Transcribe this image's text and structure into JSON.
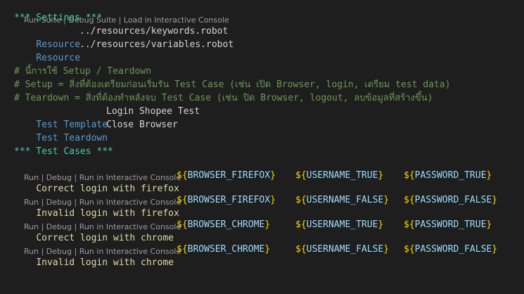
{
  "codelens": {
    "suite": {
      "run": "Run Suite",
      "debug": "Debug Suite",
      "console": "Load in Interactive Console"
    },
    "test": {
      "run": "Run",
      "debug": "Debug",
      "console": "Run in Interactive Console"
    },
    "sep": " | "
  },
  "settings": {
    "header": "*** Settings ***",
    "resources": [
      {
        "keyword": "Resource",
        "path": "../resources/keywords.robot"
      },
      {
        "keyword": "Resource",
        "path": "../resources/variables.robot"
      }
    ],
    "comments": [
      "# นี้การใช้ Setup / Teardown",
      "# Setup = สิ่งที่ต้องเตรียมก่อนเริ่มรัน Test Case (เช่น เปิด Browser, login, เตรียม test data)",
      "# Teardown = สิ่งที่ต้องทำหลังจบ Test Case (เช่น ปิด Browser, logout, ลบข้อมูลที่สร้างขึ้น)"
    ],
    "test_template": {
      "keyword": "Test Template",
      "value": "Login Shopee Test"
    },
    "test_teardown": {
      "keyword": "Test Teardown",
      "value": "Close Browser"
    }
  },
  "test_cases": {
    "header": "*** Test Cases ***",
    "rows": [
      {
        "name": "Correct login with firefox",
        "browser": "${BROWSER_FIREFOX}",
        "username": "${USERNAME_TRUE}",
        "password": "${PASSWORD_TRUE}"
      },
      {
        "name": "Invalid login with firefox",
        "browser": "${BROWSER_FIREFOX}",
        "username": "${USERNAME_FALSE}",
        "password": "${PASSWORD_FALSE}"
      },
      {
        "name": "Correct login with chrome",
        "browser": "${BROWSER_CHROME}",
        "username": "${USERNAME_TRUE}",
        "password": "${PASSWORD_TRUE}"
      },
      {
        "name": "Invalid login with chrome",
        "browser": "${BROWSER_CHROME}",
        "username": "${USERNAME_FALSE}",
        "password": "${PASSWORD_FALSE}"
      }
    ]
  },
  "colors": {
    "background": "#1e1e1e",
    "heading": "#4ec9b0",
    "setting_keyword": "#569cd6",
    "comment": "#6a9955",
    "test_name": "#dcdcaa",
    "variable_brace": "#ffd700",
    "variable_name": "#9cdcfe",
    "codelens": "#9d9d9d"
  }
}
